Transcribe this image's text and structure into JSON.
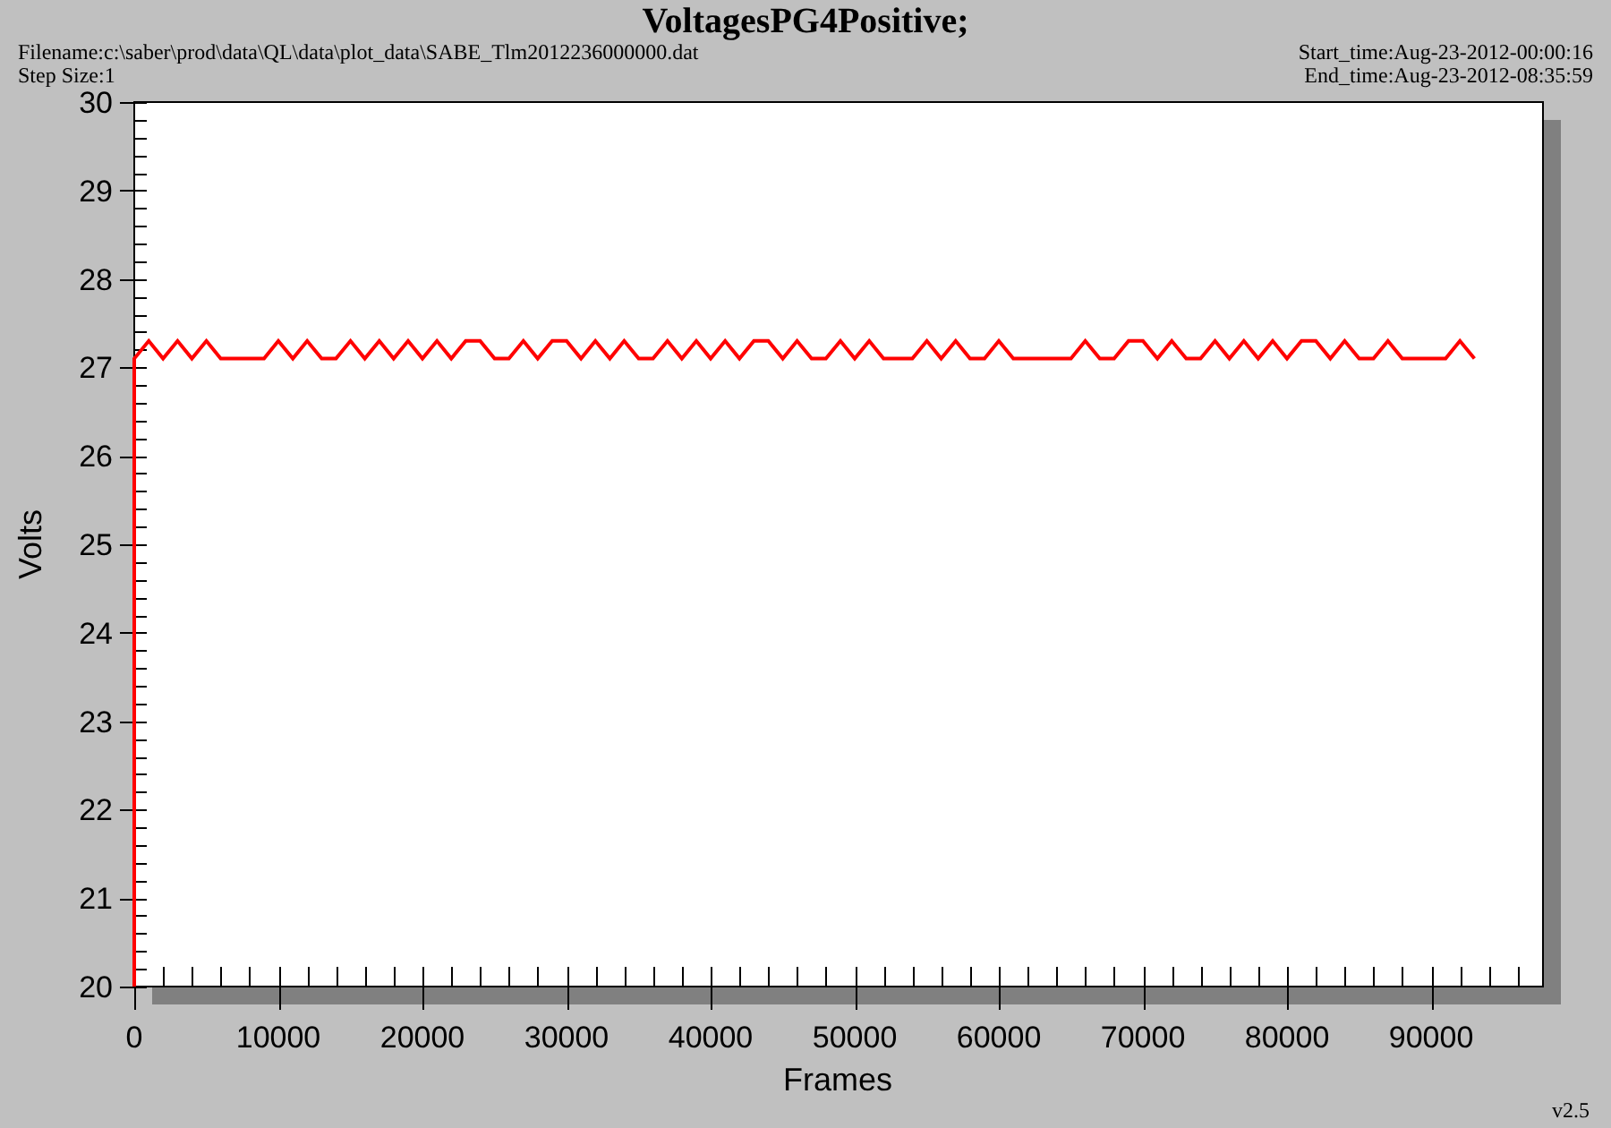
{
  "title": "VoltagesPG4Positive;",
  "filename": "Filename:c:\\saber\\prod\\data\\QL\\data\\plot_data\\SABE_Tlm2012236000000.dat",
  "step_size": "Step Size:1",
  "start_time": "Start_time:Aug-23-2012-00:00:16",
  "end_time": "End_time:Aug-23-2012-08:35:59",
  "version": "v2.5",
  "chart_data": {
    "type": "line",
    "xlabel": "Frames",
    "ylabel": "Volts",
    "x": [
      0,
      0,
      1000,
      2000,
      3000,
      4000,
      5000,
      6000,
      7000,
      8000,
      9000,
      10000,
      11000,
      12000,
      13000,
      14000,
      15000,
      16000,
      17000,
      18000,
      19000,
      20000,
      21000,
      22000,
      23000,
      24000,
      25000,
      26000,
      27000,
      28000,
      29000,
      30000,
      31000,
      32000,
      33000,
      34000,
      35000,
      36000,
      37000,
      38000,
      39000,
      40000,
      41000,
      42000,
      43000,
      44000,
      45000,
      46000,
      47000,
      48000,
      49000,
      50000,
      51000,
      52000,
      53000,
      54000,
      55000,
      56000,
      57000,
      58000,
      59000,
      60000,
      61000,
      62000,
      63000,
      64000,
      65000,
      66000,
      67000,
      68000,
      69000,
      70000,
      71000,
      72000,
      73000,
      74000,
      75000,
      76000,
      77000,
      78000,
      79000,
      80000,
      81000,
      82000,
      83000,
      84000,
      85000,
      86000,
      87000,
      88000,
      89000,
      90000,
      91000,
      92000,
      93000
    ],
    "series": [
      {
        "color": "#ff0000",
        "values": [
          20,
          27.1,
          27.3,
          27.1,
          27.3,
          27.1,
          27.3,
          27.1,
          27.1,
          27.1,
          27.1,
          27.3,
          27.1,
          27.3,
          27.1,
          27.1,
          27.3,
          27.1,
          27.3,
          27.1,
          27.3,
          27.1,
          27.3,
          27.1,
          27.3,
          27.3,
          27.1,
          27.1,
          27.3,
          27.1,
          27.3,
          27.3,
          27.1,
          27.3,
          27.1,
          27.3,
          27.1,
          27.1,
          27.3,
          27.1,
          27.3,
          27.1,
          27.3,
          27.1,
          27.3,
          27.3,
          27.1,
          27.3,
          27.1,
          27.1,
          27.3,
          27.1,
          27.3,
          27.1,
          27.1,
          27.1,
          27.3,
          27.1,
          27.3,
          27.1,
          27.1,
          27.3,
          27.1,
          27.1,
          27.1,
          27.1,
          27.1,
          27.3,
          27.1,
          27.1,
          27.3,
          27.3,
          27.1,
          27.3,
          27.1,
          27.1,
          27.3,
          27.1,
          27.3,
          27.1,
          27.3,
          27.1,
          27.3,
          27.3,
          27.1,
          27.3,
          27.1,
          27.1,
          27.3,
          27.1,
          27.1,
          27.1,
          27.1,
          27.3,
          27.1
        ]
      }
    ],
    "xlim": [
      0,
      97760
    ],
    "ylim": [
      20,
      30
    ],
    "xticks": [
      0,
      10000,
      20000,
      30000,
      40000,
      50000,
      60000,
      70000,
      80000,
      90000
    ],
    "yticks": [
      20,
      21,
      22,
      23,
      24,
      25,
      26,
      27,
      28,
      29,
      30
    ]
  }
}
